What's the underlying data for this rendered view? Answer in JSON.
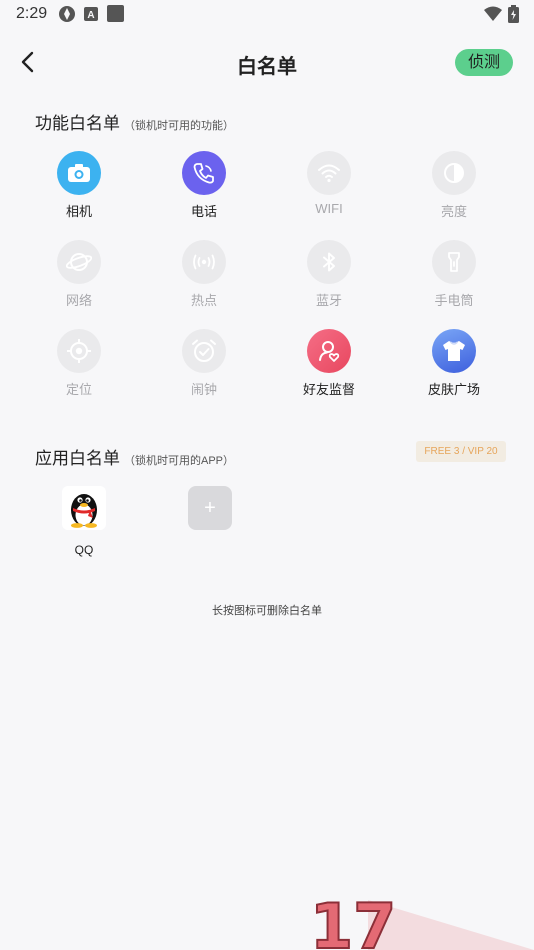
{
  "status_bar": {
    "time": "2:29",
    "icons": [
      "vpn-icon",
      "a-badge-icon",
      "square-app-icon",
      "wifi-icon",
      "battery-icon"
    ]
  },
  "header": {
    "title": "白名单",
    "detect_label": "侦测",
    "back_icon": "back-arrow-icon",
    "accent": "#5ccf8d"
  },
  "feature_section": {
    "title": "功能白名单",
    "subtitle": "（锁机时可用的功能）",
    "items": [
      {
        "label": "相机",
        "icon": "camera-icon",
        "enabled": true,
        "color": "#3cb2f0"
      },
      {
        "label": "电话",
        "icon": "phone-icon",
        "enabled": true,
        "color": "#6b62ee"
      },
      {
        "label": "WIFI",
        "icon": "wifi-icon",
        "enabled": false
      },
      {
        "label": "亮度",
        "icon": "brightness-icon",
        "enabled": false
      },
      {
        "label": "网络",
        "icon": "globe-icon",
        "enabled": false
      },
      {
        "label": "热点",
        "icon": "hotspot-icon",
        "enabled": false
      },
      {
        "label": "蓝牙",
        "icon": "bluetooth-icon",
        "enabled": false
      },
      {
        "label": "手电筒",
        "icon": "flashlight-icon",
        "enabled": false
      },
      {
        "label": "定位",
        "icon": "location-icon",
        "enabled": false
      },
      {
        "label": "闹钟",
        "icon": "alarm-icon",
        "enabled": false
      },
      {
        "label": "好友监督",
        "icon": "friend-supervise-icon",
        "enabled": true,
        "color": "#f2627d"
      },
      {
        "label": "皮肤广场",
        "icon": "skin-shirt-icon",
        "enabled": true,
        "color": "#5b86ee"
      }
    ]
  },
  "app_section": {
    "title": "应用白名单",
    "subtitle": "（锁机时可用的APP）",
    "quota": "FREE 3 / VIP 20",
    "apps": [
      {
        "label": "QQ",
        "icon": "qq-penguin-icon"
      }
    ],
    "add_label": "+"
  },
  "hint": "长按图标可删除白名单",
  "watermark_text": "17"
}
